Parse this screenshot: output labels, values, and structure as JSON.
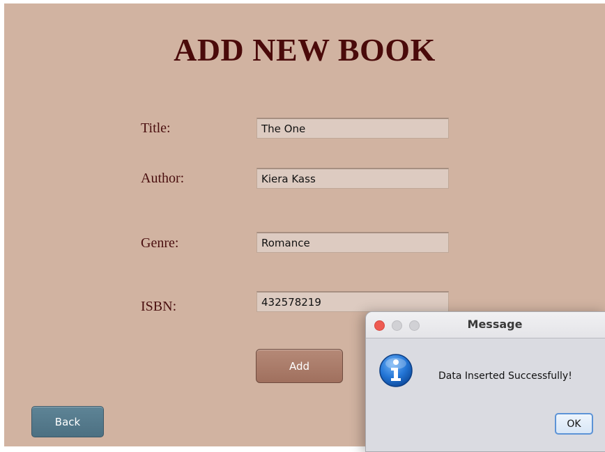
{
  "form": {
    "title": "ADD NEW BOOK",
    "fields": [
      {
        "label": "Title:",
        "value": "The One"
      },
      {
        "label": "Author:",
        "value": "Kiera Kass"
      },
      {
        "label": "Genre:",
        "value": "Romance"
      },
      {
        "label": "ISBN:",
        "value": "432578219"
      }
    ],
    "add_label": "Add",
    "back_label": "Back"
  },
  "dialog": {
    "title": "Message",
    "message": "Data Inserted Successfully!",
    "ok_label": "OK",
    "icon": "info-icon"
  },
  "colors": {
    "background": "#d1b3a1",
    "title": "#4a0a0a",
    "add_button": "#a8786a",
    "back_button": "#557a8c",
    "dialog_bg": "#dadbe1",
    "info_blue": "#1f6fd1"
  }
}
